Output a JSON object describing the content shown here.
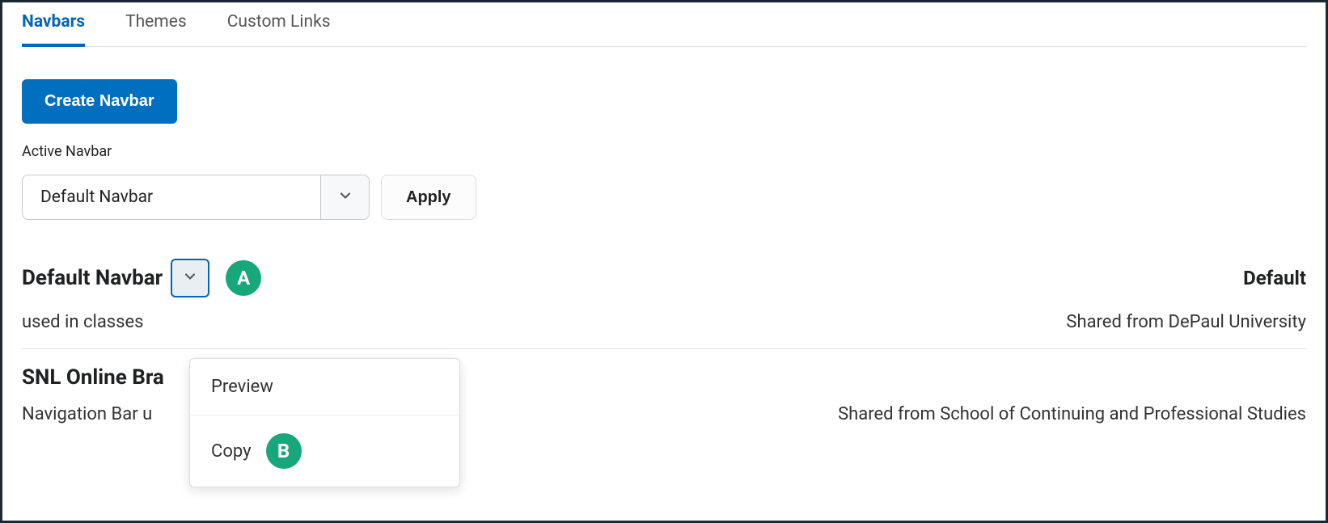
{
  "tabs": [
    {
      "label": "Navbars"
    },
    {
      "label": "Themes"
    },
    {
      "label": "Custom Links"
    }
  ],
  "buttons": {
    "create": "Create Navbar",
    "apply": "Apply"
  },
  "active_navbar": {
    "label": "Active Navbar",
    "selected": "Default Navbar"
  },
  "list": [
    {
      "title": "Default Navbar",
      "desc": "used in classes",
      "status": "Default",
      "shared": "Shared from DePaul University"
    },
    {
      "title": "SNL Online Bra",
      "desc": "Navigation Bar u",
      "status": "",
      "shared": "Shared from School of Continuing and Professional Studies"
    }
  ],
  "menu": {
    "preview": "Preview",
    "copy": "Copy"
  },
  "callouts": {
    "a": "A",
    "b": "B"
  }
}
